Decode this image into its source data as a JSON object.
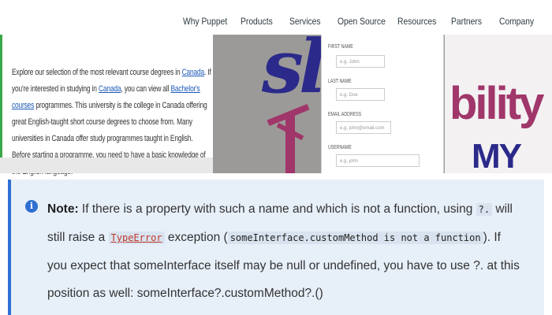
{
  "nav": {
    "items": [
      "Why Puppet",
      "Products",
      "Services",
      "Open Source",
      "Resources",
      "Partners",
      "Company"
    ]
  },
  "article": {
    "segments": [
      "Explore our selection of the most relevant course degrees in ",
      "Canada",
      ". If you're interested in studying in ",
      "Canada",
      ", you can view all ",
      "Bachelor's courses",
      " programmes. This university is the college in Canada offering great English-taught short course degrees to choose from. Many universities in Canada offer study programmes taught in English. Before starting a programme, you need to have a basic knowledge of the English language."
    ]
  },
  "screenshot": {
    "logo_left": "sla",
    "logo_right_top": "bility",
    "logo_right_bottom": "MY",
    "form_fields": [
      {
        "label": "FIRST NAME",
        "value": "e.g. John"
      },
      {
        "label": "LAST NAME",
        "value": "e.g. Doe"
      },
      {
        "label": "EMAIL ADDRESS",
        "value": "e.g. john@email.com"
      },
      {
        "label": "USERNAME",
        "value": "e.g. john"
      }
    ]
  },
  "note": {
    "icon": "info-icon",
    "label": "Note:",
    "t1": " If there is a property with such a name and which is not a function, using ",
    "c1": "?.",
    "t2": " will still raise a ",
    "c2": "TypeError",
    "t3": " exception (",
    "c3": "someInterface.customMethod is not a function",
    "t4": "). If you expect that someInterface itself may be null or undefined, you have to use ?. at this position as well: someInterface?.customMethod?.()"
  },
  "colors": {
    "accent": "#2e6fd3",
    "note_bg": "#e7eff9",
    "link": "#1a58b8",
    "logo_purple": "#a0366a",
    "logo_navy": "#2b2a8a"
  }
}
